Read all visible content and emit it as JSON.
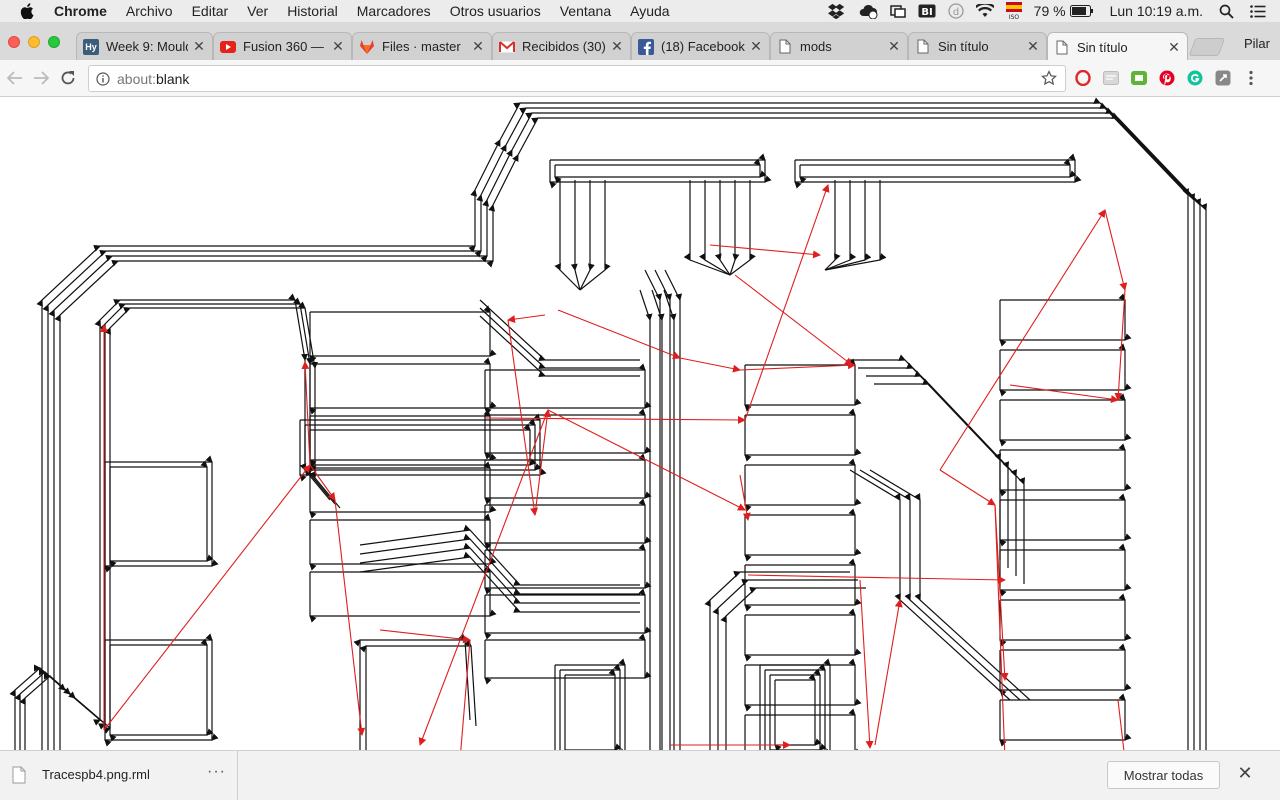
{
  "menubar": {
    "app_name": "Chrome",
    "items": [
      "Archivo",
      "Editar",
      "Ver",
      "Historial",
      "Marcadores",
      "Otros usuarios",
      "Ventana",
      "Ayuda"
    ],
    "battery_percent": "79 %",
    "clock": "Lun 10:19 a.m."
  },
  "tabs": [
    {
      "label": "Week 9: Mould",
      "favicon": "hy-icon",
      "favicon_text": "Hy",
      "favicon_color": "#3b5d7c",
      "active": false
    },
    {
      "label": "Fusion 360 — I",
      "favicon": "youtube-icon",
      "favicon_color": "#e62117",
      "active": false
    },
    {
      "label": "Files · master",
      "favicon": "gitlab-icon",
      "favicon_color": "#e24329",
      "active": false
    },
    {
      "label": "Recibidos (30)",
      "favicon": "gmail-icon",
      "favicon_color": "#d93025",
      "active": false
    },
    {
      "label": "(18) Facebook",
      "favicon": "facebook-icon",
      "favicon_color": "#3b5998",
      "active": false
    },
    {
      "label": "mods",
      "favicon": "document-icon",
      "active": false
    },
    {
      "label": "Sin título",
      "favicon": "document-icon",
      "active": false
    },
    {
      "label": "Sin título",
      "favicon": "document-icon",
      "active": true
    }
  ],
  "profile_name": "Pilar",
  "omnibox": {
    "scheme": "about:",
    "path": "blank"
  },
  "extensions": [
    "opera-icon",
    "extension-icon",
    "evernote-icon",
    "pinterest-icon",
    "grammarly-icon",
    "pocket-icon"
  ],
  "downloads": {
    "file_name": "Tracespb4.png.rml",
    "more_label": "···",
    "show_all_label": "Mostrar todas",
    "close_label": "✕"
  },
  "colors": {
    "trace": "#111111",
    "move_path": "#e01e1e",
    "tab_active": "#f6f6f6",
    "tabstrip": "#dadada"
  }
}
